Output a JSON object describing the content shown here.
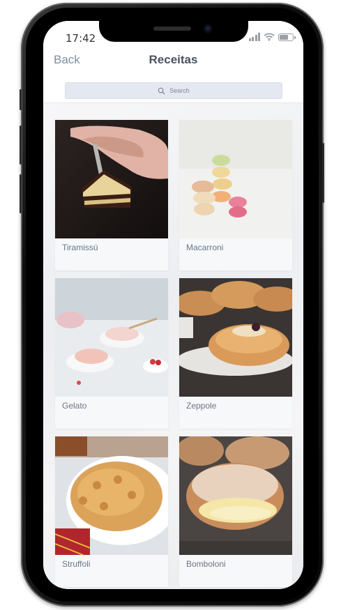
{
  "status_bar": {
    "time": "17:42"
  },
  "header": {
    "back_label": "Back",
    "title": "Receitas"
  },
  "search": {
    "placeholder": "Search"
  },
  "recipes": [
    {
      "name": "Tiramissú"
    },
    {
      "name": "Macarroni"
    },
    {
      "name": "Gelato"
    },
    {
      "name": "Zeppole"
    },
    {
      "name": "Struffoli"
    },
    {
      "name": "Bomboloni"
    }
  ]
}
